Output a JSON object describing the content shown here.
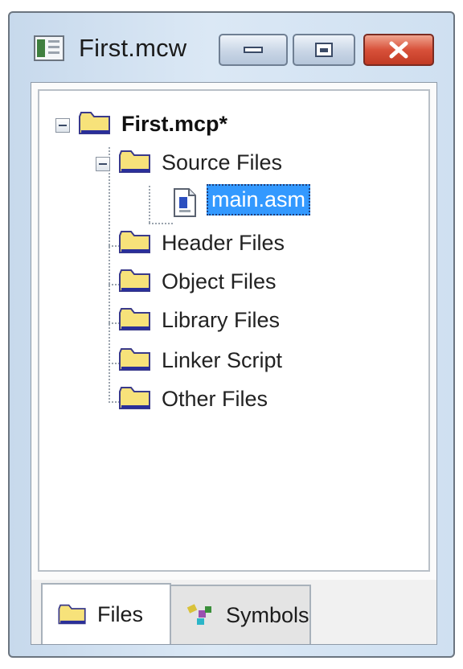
{
  "window": {
    "title": "First.mcw",
    "buttons": {
      "minimize": "minimize",
      "maximize": "restore",
      "close": "close"
    }
  },
  "tree": {
    "root": {
      "label": "First.mcp*",
      "icon": "folder-icon"
    },
    "items": [
      {
        "label": "Source Files",
        "icon": "folder-icon",
        "expanded": true,
        "children": [
          {
            "label": "main.asm",
            "icon": "asm-file-icon",
            "selected": true
          }
        ]
      },
      {
        "label": "Header Files",
        "icon": "folder-icon"
      },
      {
        "label": "Object Files",
        "icon": "folder-icon"
      },
      {
        "label": "Library Files",
        "icon": "folder-icon"
      },
      {
        "label": "Linker Script",
        "icon": "folder-icon"
      },
      {
        "label": "Other Files",
        "icon": "folder-icon"
      }
    ]
  },
  "tabs": [
    {
      "label": "Files",
      "icon": "folder-icon",
      "active": true
    },
    {
      "label": "Symbols",
      "icon": "symbols-icon",
      "active": false
    }
  ],
  "colors": {
    "selection": "#3399ff",
    "folder": "#f7e27a",
    "close_button": "#d8513a"
  }
}
